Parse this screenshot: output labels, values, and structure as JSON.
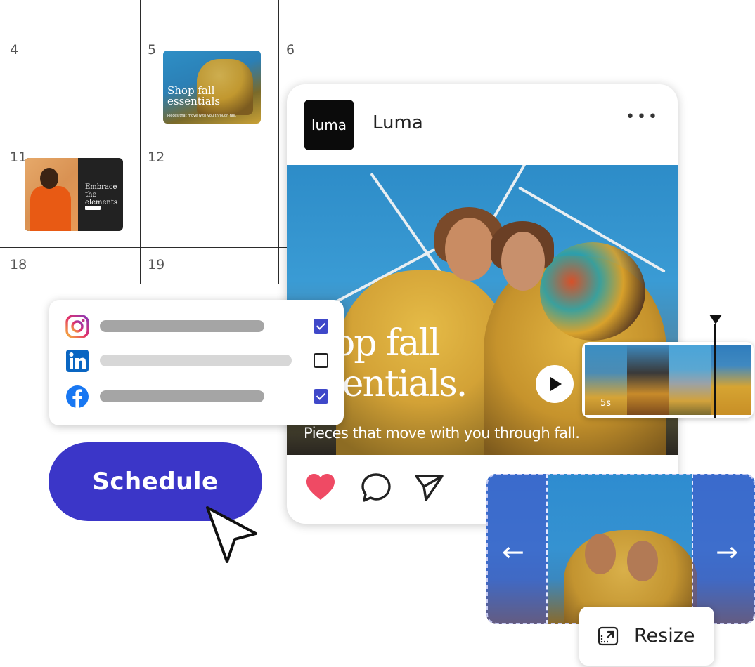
{
  "calendar": {
    "days": [
      "4",
      "5",
      "6",
      "11",
      "12",
      "18",
      "19"
    ],
    "thumb_fall": {
      "headline": "Shop fall essentials",
      "subline": "Pieces that move with you through fall."
    },
    "thumb_elements": {
      "headline": "Embrace the elements"
    }
  },
  "post": {
    "avatar_text": "luma",
    "account_name": "Luma",
    "more_label": "•••",
    "headline_line1": "op fall",
    "headline_line2": "sentials.",
    "tagline": "Pieces that move with you through fall.",
    "actions": [
      "heart-icon",
      "comment-icon",
      "send-icon"
    ],
    "like_color": "#ef4a64"
  },
  "channels": [
    {
      "network": "instagram-icon",
      "checked": true
    },
    {
      "network": "linkedin-icon",
      "checked": false
    },
    {
      "network": "facebook-icon",
      "checked": true
    }
  ],
  "schedule": {
    "label": "Schedule",
    "color": "#3b36c8"
  },
  "timeline": {
    "duration": "5s"
  },
  "crop": {
    "left_arrow": "←",
    "right_arrow": "→",
    "resize_label": "Resize"
  },
  "colors": {
    "accent": "#3f48c9",
    "instagram": "#e1306c",
    "linkedin": "#0a66c2",
    "facebook": "#1877f2"
  }
}
